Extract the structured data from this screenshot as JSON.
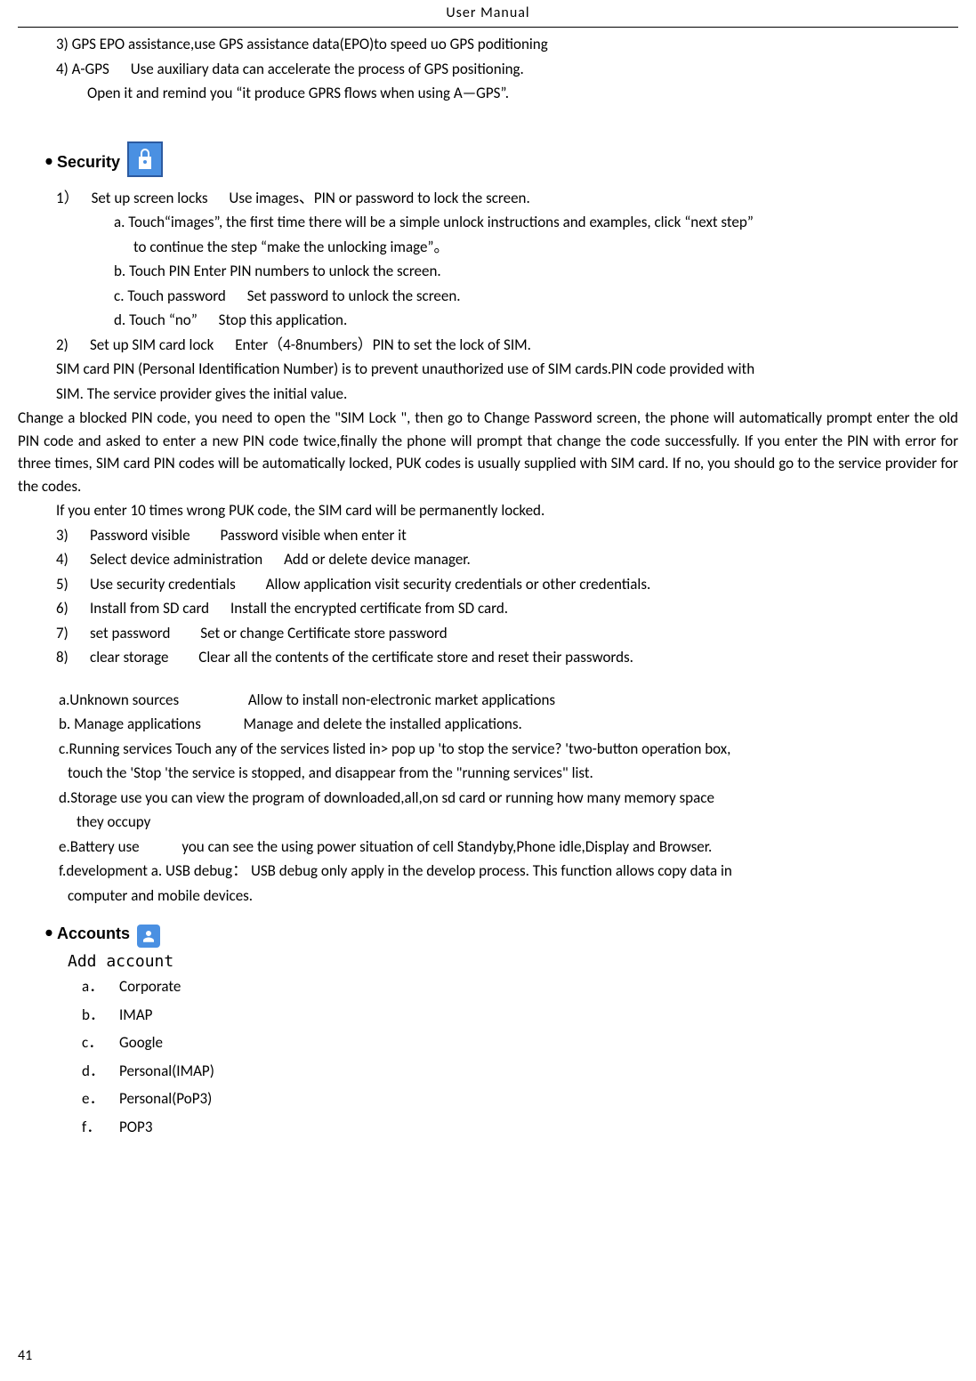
{
  "header": "User    Manual",
  "intro": {
    "l1": "3) GPS EPO assistance,use GPS assistance data(EPO)to speed uo GPS poditioning",
    "l2_a": "4) A-GPS",
    "l2_b": "Use auxiliary data can accelerate the process of GPS positioning.",
    "l3": "Open it and remind you “it produce GPRS flows when using A—GPS”."
  },
  "security": {
    "title": "Security",
    "item1_num": "1）",
    "item1_a": "Set up screen locks",
    "item1_b": "Use images、PIN or password to lock the screen.",
    "sub_a": "a. Touch“images”,    the first time there will be a simple unlock instructions and examples, click “next step”",
    "sub_a2": "to continue the step “make the unlocking image”。",
    "sub_b": "b. Touch PIN Enter PIN numbers to unlock the screen.",
    "sub_c_a": "c. Touch password",
    "sub_c_b": "Set password to unlock the screen.",
    "sub_d_a": "d. Touch “no”",
    "sub_d_b": "Stop this application.",
    "item2_num": "2)",
    "item2_a": "Set up SIM card lock",
    "item2_b": "Enter（4-8numbers）PIN to set the lock of SIM.",
    "sim_p1": "SIM card PIN (Personal Identification Number) is to prevent unauthorized use of SIM cards.PIN code provided with",
    "sim_p2": "SIM. The service provider gives the initial value.",
    "change_p": "Change a blocked PIN code, you need to open the \"SIM Lock \", then go to Change Password screen, the phone will automatically prompt enter the old PIN code and asked to enter a new PIN code twice,finally the phone will prompt that change the code successfully. If you enter the PIN with error for three times, SIM card PIN codes will be automatically locked, PUK codes is usually supplied with SIM card. If no, you should go to the service provider for the codes.",
    "puk": "If you enter 10 times wrong PUK code, the SIM card will be permanently locked.",
    "item3_num": "3)",
    "item3_a": "Password visible",
    "item3_b": "Password visible when enter it",
    "item4_num": "4)",
    "item4_a": "Select device administration",
    "item4_b": "Add or delete device manager.",
    "item5_num": "5)",
    "item5_a": "Use security credentials",
    "item5_b": "Allow application visit security credentials or other credentials.",
    "item6_num": "6)",
    "item6_a": "Install from SD card",
    "item6_b": "Install the encrypted certificate from SD card.",
    "item7_num": "7)",
    "item7_a": "set password",
    "item7_b": "Set or change Certificate store password",
    "item8_num": "8)",
    "item8_a": "clear storage",
    "item8_b": "Clear all the contents of the certificate store and reset their passwords.",
    "la_a": "a.Unknown sources",
    "la_b": "Allow to install non-electronic market applications",
    "lb_a": "b. Manage applications",
    "lb_b": "Manage and delete the installed applications.",
    "lc": "c.Running services      Touch any of the services listed in> pop up 'to stop the service? 'two-button operation box,",
    "lc2": "touch the 'Stop 'the service is stopped, and disappear from the \"running services\" list.",
    "ld": "d.Storage use          you can view the program of downloaded,all,on sd card or running    how many memory space",
    "ld2": "they occupy",
    "le_a": "e.Battery use",
    "le_b": "you can see the using power situation of cell Standyby,Phone idle,Display and Browser.",
    "lf": "f.development          a. USB debug： USB debug only apply in the develop process. This function allows copy data in",
    "lf2": "computer and mobile devices."
  },
  "accounts": {
    "title": "Accounts",
    "add": "Add account",
    "a_lt": "a．",
    "a_v": "Corporate",
    "b_lt": "b．",
    "b_v": "IMAP",
    "c_lt": "c．",
    "c_v": "Google",
    "d_lt": "d．",
    "d_v": "Personal(IMAP)",
    "e_lt": "e．",
    "e_v": "Personal(PoP3)",
    "f_lt": "f．",
    "f_v": "POP3"
  },
  "page": "41"
}
